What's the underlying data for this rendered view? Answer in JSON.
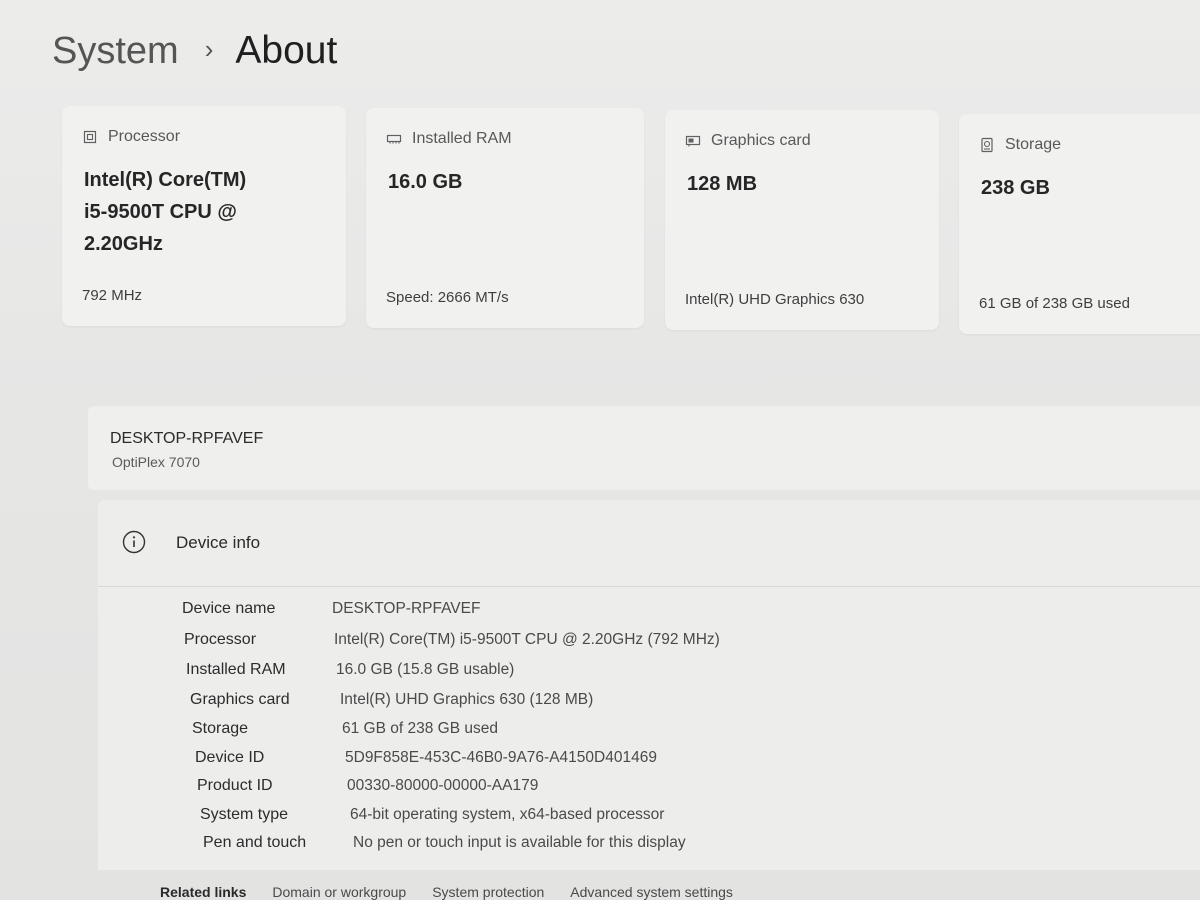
{
  "breadcrumb": {
    "parent": "System",
    "separator": "›",
    "current": "About"
  },
  "cards": [
    {
      "icon": "processor-icon",
      "label": "Processor",
      "value_lines": [
        "Intel(R) Core(TM)",
        "i5-9500T CPU @",
        "2.20GHz"
      ],
      "sub": "792 MHz"
    },
    {
      "icon": "ram-icon",
      "label": "Installed RAM",
      "value": "16.0 GB",
      "sub": "Speed: 2666 MT/s"
    },
    {
      "icon": "graphics-card-icon",
      "label": "Graphics card",
      "value": "128 MB",
      "sub": "Intel(R) UHD Graphics 630"
    },
    {
      "icon": "storage-icon",
      "label": "Storage",
      "value": "238 GB",
      "sub": "61 GB of 238 GB used"
    }
  ],
  "device": {
    "name": "DESKTOP-RPFAVEF",
    "model": "OptiPlex 7070"
  },
  "device_info": {
    "title": "Device info",
    "rows": [
      {
        "key": "Device name",
        "value": "DESKTOP-RPFAVEF"
      },
      {
        "key": "Processor",
        "value": "Intel(R) Core(TM) i5-9500T CPU @ 2.20GHz (792 MHz)"
      },
      {
        "key": "Installed RAM",
        "value": "16.0 GB (15.8 GB usable)"
      },
      {
        "key": "Graphics card",
        "value": "Intel(R) UHD Graphics 630 (128 MB)"
      },
      {
        "key": "Storage",
        "value": "61 GB of 238 GB used"
      },
      {
        "key": "Device ID",
        "value": "5D9F858E-453C-46B0-9A76-A4150D401469"
      },
      {
        "key": "Product ID",
        "value": "00330-80000-00000-AA179"
      },
      {
        "key": "System type",
        "value": "64-bit operating system, x64-based processor"
      },
      {
        "key": "Pen and touch",
        "value": "No pen or touch input is available for this display"
      }
    ]
  },
  "related_links": {
    "label": "Related links",
    "links": [
      "Domain or workgroup",
      "System protection",
      "Advanced system settings"
    ]
  }
}
